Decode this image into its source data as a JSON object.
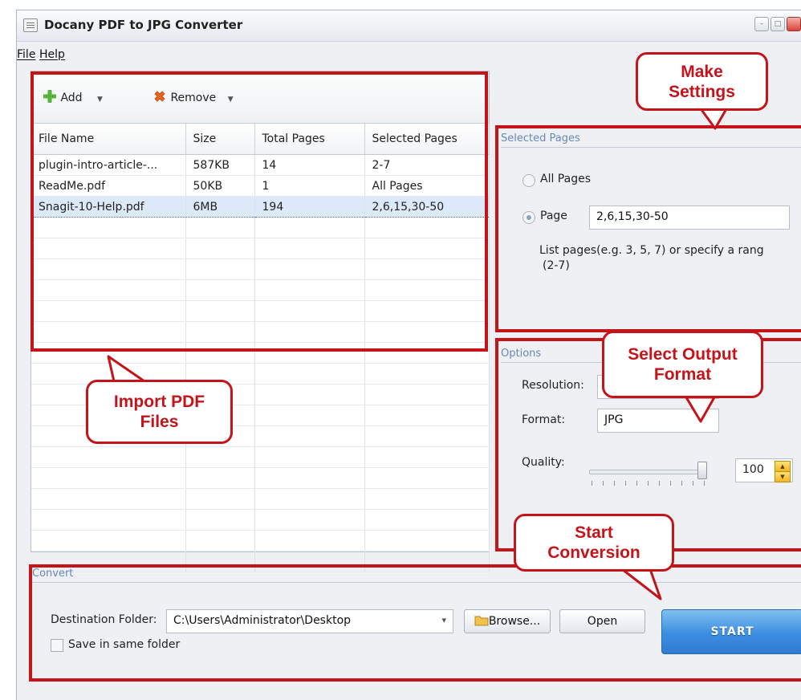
{
  "window": {
    "title": "Docany PDF to JPG Converter",
    "minimize_glyph": "–",
    "maximize_glyph": "□"
  },
  "menu": {
    "file": "File",
    "help": "Help"
  },
  "toolbar": {
    "add_label": "Add",
    "remove_label": "Remove",
    "dropdown_glyph": "▼"
  },
  "table": {
    "columns": [
      "File Name",
      "Size",
      "Total Pages",
      "Selected Pages"
    ],
    "rows": [
      [
        "plugin-intro-article-...",
        "587KB",
        "14",
        "2-7"
      ],
      [
        "ReadMe.pdf",
        "50KB",
        "1",
        "All Pages"
      ],
      [
        "Snagit-10-Help.pdf",
        "6MB",
        "194",
        "2,6,15,30-50"
      ]
    ],
    "selected_row": 2
  },
  "selected_pages": {
    "group_label": "Selected Pages",
    "all_pages_label": "All Pages",
    "page_label": "Page",
    "page_value": "2,6,15,30-50",
    "hint_line1": "List pages(e.g. 3, 5, 7)  or specify a  rang",
    "hint_line2": "(2-7)",
    "selected_option": "page"
  },
  "options": {
    "group_label": "Options",
    "resolution_label": "Resolution:",
    "format_label": "Format:",
    "format_value": "JPG",
    "quality_label": "Quality:",
    "quality_value": "100",
    "quality_level": 1.0
  },
  "convert": {
    "group_label": "Convert",
    "destination_label": "Destination Folder:",
    "destination_value": "C:\\Users\\Administrator\\Desktop",
    "dropdown_glyph": "▾",
    "browse_label": "Browse...",
    "open_label": "Open",
    "start_label": "START",
    "same_folder_label": "Save in same folder",
    "same_folder_checked": false
  },
  "callouts": {
    "make_settings": [
      "Make",
      "Settings"
    ],
    "select_output": [
      "Select Output",
      "Format"
    ],
    "import_pdf": [
      "Import PDF",
      "Files"
    ],
    "start_conversion": [
      "Start",
      "Conversion"
    ]
  },
  "colors": {
    "annotation_red": "#c4141a",
    "start_blue": "#3c8ee0",
    "selection_blue": "#dbe9f8"
  },
  "icons": {
    "add": "green-plus-icon",
    "remove": "orange-x-icon",
    "folder": "folder-icon"
  }
}
